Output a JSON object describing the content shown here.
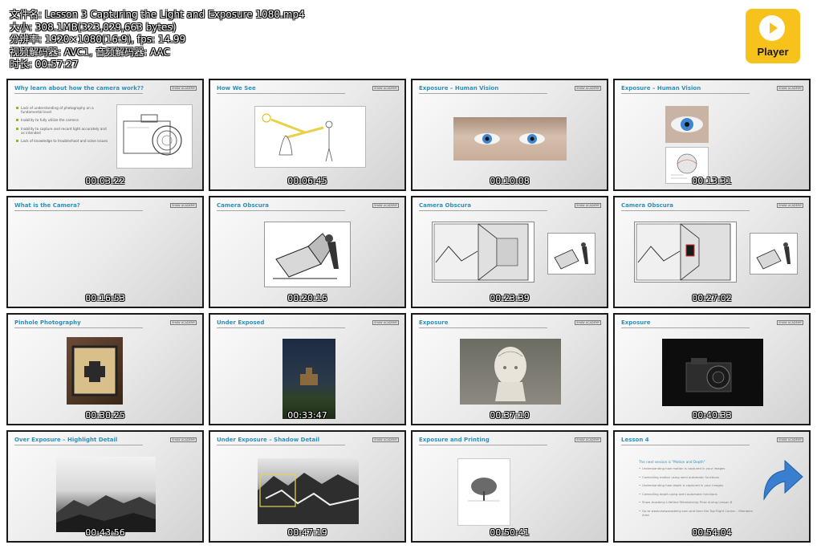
{
  "file_info": {
    "filename_line": "文件名: Lesson 3 Capturing the Light and Exposure 1080.mp4",
    "size_line": "大小: 308.1MB(323,029,663 bytes)",
    "resolution_line": "分辨率: 1920×1080(16:9), fps: 14.99",
    "codec_line": "视频解码器: AVC1, 音频解码器: AAC",
    "duration_line": "时长: 00:57:27"
  },
  "player_logo": {
    "label": "Player",
    "icon": "play-icon",
    "color": "#f7c21b"
  },
  "accent_color": "#2f8fb8",
  "thumbnails": [
    {
      "title": "Why learn about how the camera work??",
      "timestamp": "00:03:22",
      "brand": "SHAW ACADEMY",
      "bullets": [
        "Lack of understanding of photography on a fundamental level",
        "Inability to fully utilize the camera",
        "Inability to capture and record light accurately and as intended",
        "Lack of knowledge to troubleshoot and solve issues"
      ],
      "image": "camera-sketch"
    },
    {
      "title": "How We See",
      "timestamp": "00:06:45",
      "brand": "SHAW ACADEMY",
      "image": "how-we-see-diagram"
    },
    {
      "title": "Exposure – Human Vision",
      "timestamp": "00:10:08",
      "brand": "SHAW ACADEMY",
      "image": "eyes-photo"
    },
    {
      "title": "Exposure – Human Vision",
      "timestamp": "00:13:31",
      "brand": "SHAW ACADEMY",
      "image": "eye-closeup-and-diagram"
    },
    {
      "title": "What is the Camera?",
      "timestamp": "00:16:53",
      "brand": "SHAW ACADEMY"
    },
    {
      "title": "Camera Obscura",
      "timestamp": "00:20:16",
      "brand": "SHAW ACADEMY",
      "image": "camera-obscura-engraving"
    },
    {
      "title": "Camera Obscura",
      "timestamp": "00:23:39",
      "brand": "SHAW ACADEMY",
      "image": "camera-obscura-room"
    },
    {
      "title": "Camera Obscura",
      "timestamp": "00:27:02",
      "brand": "SHAW ACADEMY",
      "image": "camera-obscura-room-highlight"
    },
    {
      "title": "Pinhole Photography",
      "timestamp": "00:30:25",
      "brand": "SHAW ACADEMY",
      "image": "pinhole-box"
    },
    {
      "title": "Under Exposed",
      "timestamp": "00:33:47",
      "brand": "SHAW ACADEMY",
      "image": "dark-landscape"
    },
    {
      "title": "Exposure",
      "timestamp": "00:37:10",
      "brand": "SHAW ACADEMY",
      "image": "phrenology-head"
    },
    {
      "title": "Exposure",
      "timestamp": "00:40:33",
      "brand": "SHAW ACADEMY",
      "image": "medium-format-camera"
    },
    {
      "title": "Over Exposure – Highlight Detail",
      "timestamp": "00:43:56",
      "brand": "SHAW ACADEMY",
      "image": "bw-mountains"
    },
    {
      "title": "Under Exposure – Shadow Detail",
      "timestamp": "00:47:19",
      "brand": "SHAW ACADEMY",
      "image": "bw-mountains-shadow"
    },
    {
      "title": "Exposure and Printing",
      "timestamp": "00:50:41",
      "brand": "SHAW ACADEMY",
      "image": "tree-print"
    },
    {
      "title": "Lesson 4",
      "timestamp": "00:54:04",
      "brand": "SHAW ACADEMY",
      "image": "arrow-icon",
      "lesson4": {
        "next_session": "The next session is \"Motion and Depth\"",
        "items": [
          "Understanding how motion is captured in your images",
          "Controlling motion using semi automatic functions",
          "Understanding how depth is captured in your images",
          "Controlling depth using semi automatic functions"
        ],
        "membership": "Shaw Academy Lifetime Membership Prize during Lesson 8",
        "goto": "Go to www.shawacademy.com and then the Top Right Corner – Members Area"
      }
    }
  ]
}
